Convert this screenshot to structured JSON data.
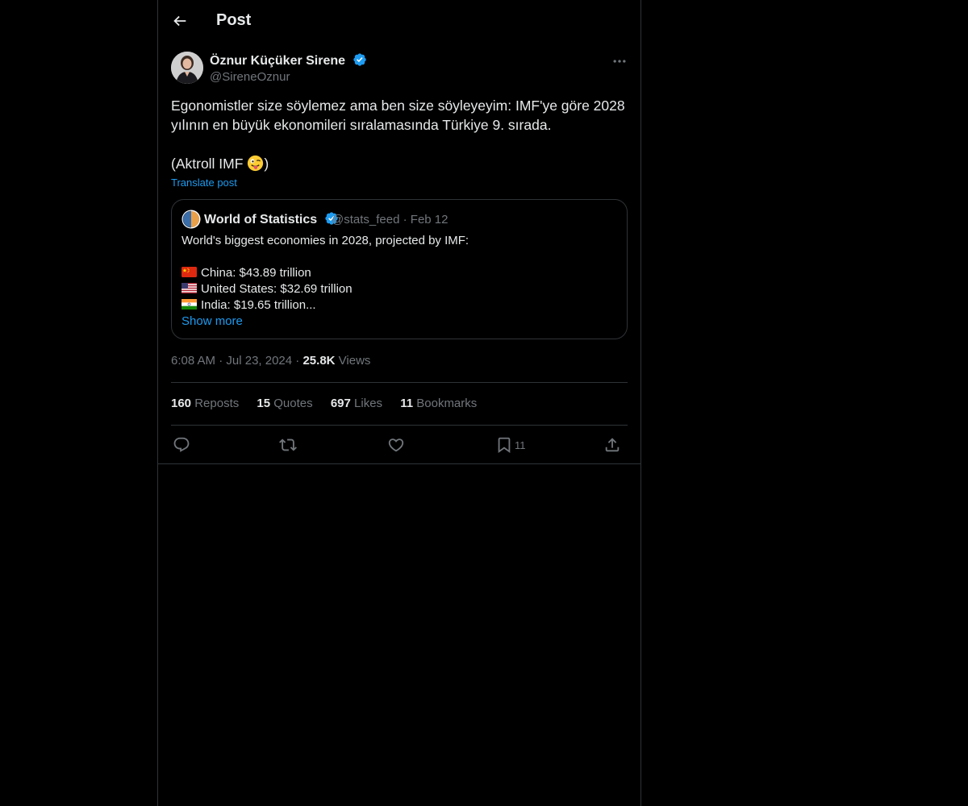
{
  "header": {
    "title": "Post"
  },
  "author": {
    "name": "Öznur Küçüker Sirene",
    "handle": "@SireneOznur"
  },
  "post": {
    "text_line_1": "Egonomistler size söylemez ama ben size söyleyeyim: IMF'ye göre 2028 yılının en büyük ekonomileri sıralamasında Türkiye 9. sırada.",
    "text_line_2_prefix": "(Aktroll IMF ",
    "text_line_2_suffix": ")",
    "translate_label": "Translate post"
  },
  "quote": {
    "name": "World of Statistics",
    "handle": "@stats_feed",
    "separator": "·",
    "date": "Feb 12",
    "intro": "World's biggest economies in 2028, projected by IMF:",
    "items": [
      {
        "text": "China: $43.89 trillion",
        "flag": "china-flag-icon"
      },
      {
        "text": "United States: $32.69 trillion",
        "flag": "us-flag-icon"
      },
      {
        "text": "India: $19.65 trillion...",
        "flag": "india-flag-icon"
      }
    ],
    "show_more": "Show more"
  },
  "meta": {
    "time": "6:08 AM",
    "separator": "·",
    "date": "Jul 23, 2024",
    "views_count": "25.8K",
    "views_label": "Views"
  },
  "stats": {
    "reposts_count": "160",
    "reposts_label": "Reposts",
    "quotes_count": "15",
    "quotes_label": "Quotes",
    "likes_count": "697",
    "likes_label": "Likes",
    "bookmarks_count": "11",
    "bookmarks_label": "Bookmarks"
  },
  "actions": {
    "bookmark_count": "11"
  },
  "colors": {
    "background": "#000000",
    "text_primary": "#e7e9ea",
    "text_secondary": "#71767b",
    "accent": "#1d9bf0",
    "border": "#2f3336"
  }
}
